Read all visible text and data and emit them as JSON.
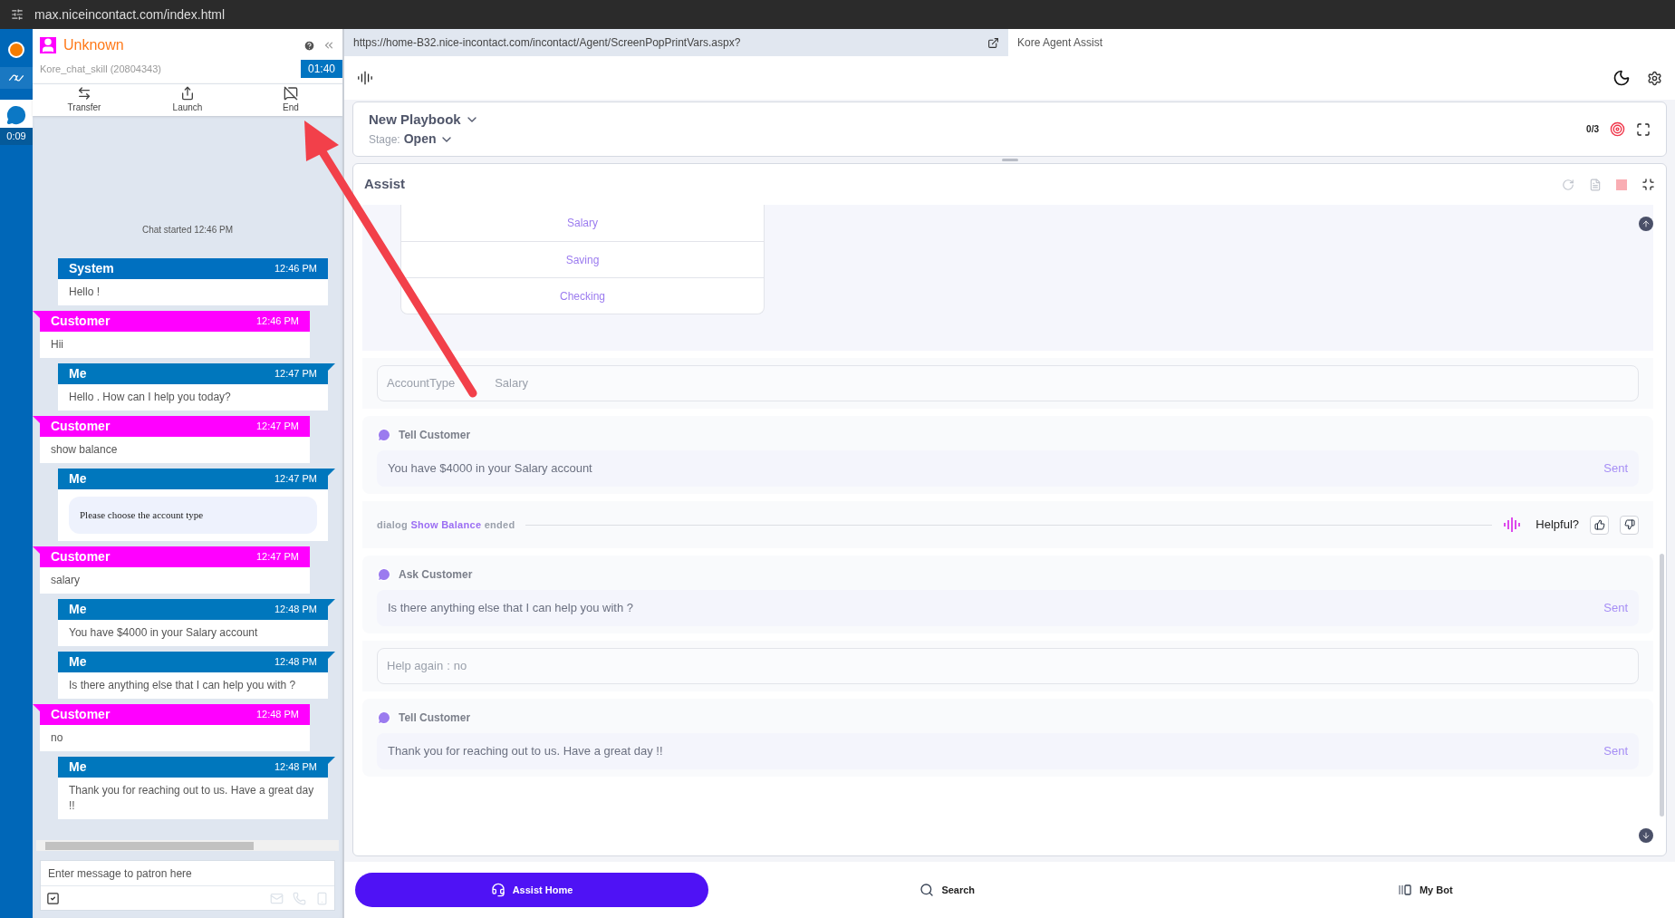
{
  "browser": {
    "url": "max.niceincontact.com/index.html"
  },
  "rail": {
    "timer": "0:09"
  },
  "contact": {
    "name": "Unknown",
    "skill": "Kore_chat_skill (20804343)",
    "timer": "01:40"
  },
  "actions": [
    {
      "label": "Transfer",
      "kind": "transfer"
    },
    {
      "label": "Launch",
      "kind": "launch"
    },
    {
      "label": "End",
      "kind": "end"
    }
  ],
  "chat": {
    "started": "Chat started 12:46 PM",
    "messages": [
      {
        "sender": "System",
        "time": "12:46 PM",
        "text": "Hello !",
        "kind": "system"
      },
      {
        "sender": "Customer",
        "time": "12:46 PM",
        "text": "Hii",
        "kind": "customer"
      },
      {
        "sender": "Me",
        "time": "12:47 PM",
        "text": "Hello . How can I help you today?",
        "kind": "agent"
      },
      {
        "sender": "Customer",
        "time": "12:47 PM",
        "text": "show balance",
        "kind": "customer"
      },
      {
        "sender": "Me",
        "time": "12:47 PM",
        "text": "Please choose the account type",
        "kind": "agent_card"
      },
      {
        "sender": "Customer",
        "time": "12:47 PM",
        "text": "salary",
        "kind": "customer"
      },
      {
        "sender": "Me",
        "time": "12:48 PM",
        "text": "You have $4000 in your Salary account",
        "kind": "agent"
      },
      {
        "sender": "Me",
        "time": "12:48 PM",
        "text": "Is there anything else that I can help you with ?",
        "kind": "agent"
      },
      {
        "sender": "Customer",
        "time": "12:48 PM",
        "text": "no",
        "kind": "customer"
      },
      {
        "sender": "Me",
        "time": "12:48 PM",
        "text": "Thank you for reaching out to us. Have a great day !!",
        "kind": "agent"
      }
    ]
  },
  "composer": {
    "placeholder": "Enter message to patron here"
  },
  "frame": {
    "url": "https://home-B32.nice-incontact.com/incontact/Agent/ScreenPopPrintVars.aspx?",
    "tab": "Kore Agent Assist"
  },
  "playbook": {
    "title": "New Playbook",
    "stage_label": "Stage:",
    "stage": "Open",
    "progress": "0/3"
  },
  "assist": {
    "title": "Assist",
    "options": [
      "Salary",
      "Saving",
      "Checking"
    ],
    "items": [
      {
        "kind": "entity",
        "label": "AccountType",
        "value": "Salary"
      },
      {
        "kind": "message",
        "label": "Tell Customer",
        "text": "You have $4000 in your Salary account",
        "status": "Sent"
      },
      {
        "kind": "dialog_end",
        "prefix": "dialog",
        "name": "Show Balance",
        "suffix": "ended",
        "feedback": "Helpful?"
      },
      {
        "kind": "message",
        "label": "Ask Customer",
        "text": "Is there anything else that I can help you with ?",
        "status": "Sent"
      },
      {
        "kind": "entity",
        "label": "Help again",
        "separator": ":",
        "value": "no"
      },
      {
        "kind": "message",
        "label": "Tell Customer",
        "text": "Thank you for reaching out to us. Have a great day !!",
        "status": "Sent"
      }
    ]
  },
  "nav": [
    {
      "label": "Assist Home",
      "kind": "home",
      "selected": true
    },
    {
      "label": "Search",
      "kind": "search",
      "selected": false
    },
    {
      "label": "My Bot",
      "kind": "bot",
      "selected": false
    }
  ]
}
